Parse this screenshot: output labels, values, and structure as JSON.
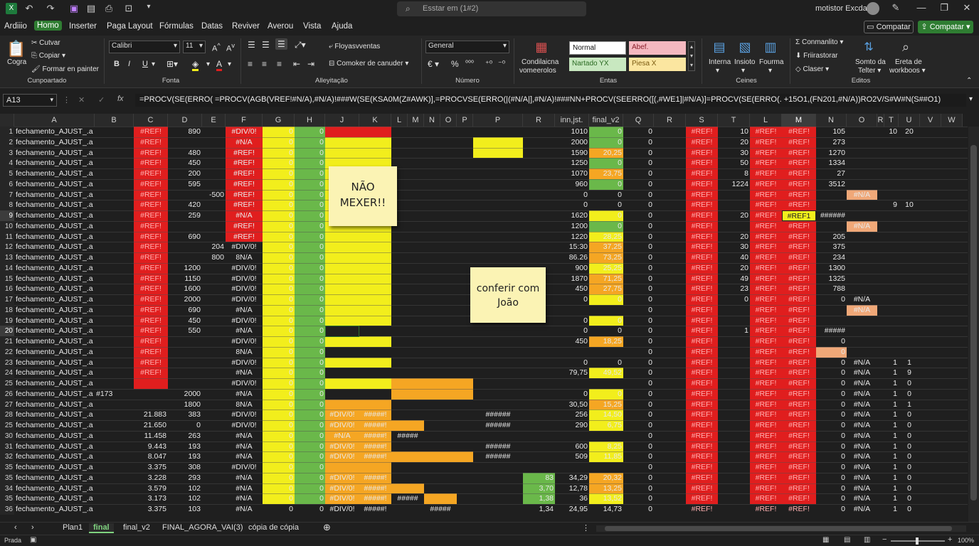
{
  "title_bar": {
    "search_placeholder": "Esstar em (1#2)",
    "user_name": "motistor Excda"
  },
  "menu": [
    "Ardiiio",
    "Homo",
    "Inserter",
    "Paga Layout",
    "Fórmulas",
    "Datas",
    "Reviver",
    "Averou",
    "Vista",
    "Ajuda"
  ],
  "menu_active": "Homo",
  "share_buttons": {
    "comment": "Compatar",
    "share": "Compatar"
  },
  "ribbon": {
    "clipboard": {
      "paste": "Cogra",
      "cut": "Cutvar",
      "copy": "Copiar",
      "format_painter": "Formar en painter",
      "group": "Cunpoartado"
    },
    "font": {
      "name": "Calibri",
      "size": "11",
      "group": "Fonta",
      "bold": "B",
      "italic": "I",
      "underline": "U"
    },
    "align": {
      "wrap": "Floyasvventas",
      "merge": "Comoker de canuder",
      "group": "Alleyitação"
    },
    "number": {
      "format": "General",
      "currency": "€",
      "percent": "%",
      "group": "Número"
    },
    "styles": {
      "conditional": "Condilaicna",
      "conditional2": "vomeerolos",
      "normal": "Normal",
      "bad": "Abef.",
      "neutral": "Nartado YX",
      "good": "Piesa X",
      "group": "Entas"
    },
    "cells": {
      "insert": "Interna",
      "delete": "Insioto",
      "format": "Fourma",
      "group": "Ceines"
    },
    "editing": {
      "autosum": "Conmanlito",
      "fill": "Friirastorar",
      "clear": "Claser",
      "sort": "Somto da",
      "sort2": "Telter",
      "find": "Ereta de",
      "find2": "workboos",
      "group": "Editos"
    }
  },
  "formula_bar": {
    "namebox": "A13",
    "fx": "fx",
    "formula": "=PROCV(SE(ERRO(  =PROCV(AGB(VREF!#N/A),#N/A)!###W(SE(KSA0M(Z#AWK)],=PROCVSE(ERRO(|(#N/A|],#N/A)!###NN+PROCV(SEERRO([(,#WE1]|#N/A)]=PROCV(SE(ERRO(.  +15O1,(FN201,#N/A))RO2V/S#W#N(S##O1)"
  },
  "columns": [
    {
      "l": "A",
      "w": 113
    },
    {
      "l": "B",
      "w": 55
    },
    {
      "l": "C",
      "w": 48
    },
    {
      "l": "D",
      "w": 48
    },
    {
      "l": "E",
      "w": 33
    },
    {
      "l": "F",
      "w": 52
    },
    {
      "l": "G",
      "w": 45
    },
    {
      "l": "H",
      "w": 43
    },
    {
      "l": "J",
      "w": 48
    },
    {
      "l": "K",
      "w": 45
    },
    {
      "l": "L",
      "w": 23
    },
    {
      "l": "M",
      "w": 23
    },
    {
      "l": "N",
      "w": 23
    },
    {
      "l": "O",
      "w": 23
    },
    {
      "l": "P",
      "w": 23
    },
    {
      "l": "P",
      "w": 70
    },
    {
      "l": "R",
      "w": 45
    },
    {
      "l": "inn,jst.",
      "w": 48
    },
    {
      "l": "final_v2",
      "w": 48
    },
    {
      "l": "Q",
      "w": 43
    },
    {
      "l": "R",
      "w": 45
    },
    {
      "l": "S",
      "w": 45
    },
    {
      "l": "T",
      "w": 45
    },
    {
      "l": "L",
      "w": 45
    },
    {
      "l": "M",
      "w": 48
    },
    {
      "l": "N",
      "w": 43
    },
    {
      "l": "O",
      "w": 43
    },
    {
      "l": "R",
      "w": 10
    },
    {
      "l": "T",
      "w": 20
    },
    {
      "l": "U",
      "w": 30
    },
    {
      "l": "V",
      "w": 30
    },
    {
      "l": "W",
      "w": 30
    }
  ],
  "row_numbers": [
    "1",
    "2",
    "3",
    "4",
    "5",
    "6",
    "7",
    "8",
    "9",
    "10",
    "11",
    "12",
    "13",
    "14",
    "15",
    "16",
    "17",
    "18",
    "19",
    "20",
    "21",
    "22",
    "23",
    "24",
    "25",
    "26",
    "27",
    "28",
    "25",
    "30",
    "31",
    "32",
    "35",
    "35",
    "34",
    "35",
    "36"
  ],
  "rows": [
    {
      "D": "890",
      "F": "#DIV/0!",
      "G": "0",
      "H": "0",
      "inn": "1010",
      "fv2": "0",
      "Q": "0",
      "T": "10",
      "N": "105",
      "Tb": "10",
      "U": "20"
    },
    {
      "F": "#N/A",
      "G": "0",
      "H": "0",
      "inn": "2000",
      "fv2": "0",
      "Q": "0",
      "T": "20",
      "N": "273"
    },
    {
      "D": "480",
      "F": "#REF!",
      "G": "0",
      "H": "0",
      "inn": "1590",
      "fv2": "20,25",
      "Q": "0",
      "T": "30",
      "N": "1270"
    },
    {
      "D": "450",
      "F": "#REF!",
      "G": "0",
      "H": "0",
      "inn": "1250",
      "fv2": "0",
      "Q": "0",
      "T": "50",
      "N": "1334"
    },
    {
      "D": "200",
      "F": "#REF!",
      "G": "0",
      "H": "0",
      "inn": "1070",
      "fv2": "23,75",
      "Q": "0",
      "T": "8",
      "N": "27"
    },
    {
      "D": "595",
      "F": "#REF!",
      "G": "0",
      "H": "0",
      "inn": "960",
      "fv2": "0",
      "Q": "0",
      "S": "",
      "T": "1224",
      "N": "3512"
    },
    {
      "E": "-500",
      "F": "#REF!",
      "G": "0",
      "H": "0",
      "inn": "0",
      "fv2": "0",
      "Q": "0",
      "O": "#N/A"
    },
    {
      "D": "420",
      "F": "#REF!",
      "G": "0",
      "H": "0",
      "inn": "0",
      "fv2": "0",
      "Q": "0",
      "Tb": "9",
      "U": "10"
    },
    {
      "D": "259",
      "F": "#N/A",
      "G": "0",
      "H": "0",
      "inn": "1620",
      "fv2": "0",
      "Q": "0",
      "T": "20",
      "M": "#REF1",
      "N": "######"
    },
    {
      "F": "#REF!",
      "G": "0",
      "H": "0",
      "inn": "1200",
      "fv2": "0",
      "Q": "0",
      "O": "#N/A"
    },
    {
      "D": "690",
      "F": "#REF!",
      "G": "0",
      "H": "0",
      "inn": "1220",
      "fv2": "28,25",
      "Q": "0",
      "T": "20",
      "N": "205"
    },
    {
      "E": "204",
      "F": "#DIV/0!",
      "G": "0",
      "H": "0",
      "inn": "15:30",
      "fv2": "37,25",
      "Q": "0",
      "T": "30",
      "N": "375"
    },
    {
      "E": "800",
      "F": "8N/A",
      "G": "0",
      "H": "0",
      "inn": "86.26",
      "fv2": "73,25",
      "Q": "0",
      "T": "40",
      "N": "234"
    },
    {
      "D": "1200",
      "F": "#DIV/0!",
      "G": "0",
      "H": "0",
      "inn": "900",
      "fv2": "25,25",
      "Q": "0",
      "T": "20",
      "N": "1300"
    },
    {
      "D": "1150",
      "F": "#DIV/0!",
      "G": "0",
      "H": "0",
      "inn": "1870",
      "fv2": "71,25",
      "Q": "0",
      "T": "49",
      "N": "1325"
    },
    {
      "D": "1600",
      "F": "#DIV/0!",
      "G": "0",
      "H": "0",
      "inn": "450",
      "fv2": "27,75",
      "Q": "0",
      "T": "23",
      "N": "788"
    },
    {
      "D": "2000",
      "F": "#DIV/0!",
      "G": "0",
      "H": "0",
      "inn": "0",
      "fv2": "0",
      "Q": "0",
      "T": "0",
      "N": "0",
      "O": "#N/A"
    },
    {
      "D": "690",
      "F": "#N/A",
      "G": "0",
      "H": "0",
      "Q": "0",
      "O": "#N/A"
    },
    {
      "D": "450",
      "F": "#DIV/0!",
      "G": "0",
      "H": "0",
      "inn": "0",
      "fv2": "0",
      "Q": "0"
    },
    {
      "D": "550",
      "F": "#N/A",
      "G": "0",
      "H": "0",
      "inn": "0",
      "fv2": "0",
      "Q": "0",
      "T": "1",
      "N": "#####"
    },
    {
      "F": "#DIV/0!",
      "G": "0",
      "H": "0",
      "inn": "450",
      "fv2": "18,25",
      "Q": "0",
      "N": "0"
    },
    {
      "F": "8N/A",
      "G": "0",
      "H": "0",
      "Q": "0",
      "N": "0"
    },
    {
      "F": "#DIV/0!",
      "G": "0",
      "H": "0",
      "inn": "0",
      "fv2": "0",
      "Q": "0",
      "N": "0",
      "O": "#N/A",
      "Tb": "1",
      "U": "1"
    },
    {
      "F": "#N/A",
      "G": "0",
      "H": "0",
      "inn": "79,75",
      "fv2": "49,52",
      "Q": "0",
      "N": "0",
      "O": "#N/A",
      "Tb": "1",
      "U": "9"
    },
    {
      "F": "#DIV/0!",
      "G": "0",
      "H": "0",
      "Q": "0",
      "N": "0",
      "O": "#N/A",
      "Tb": "1",
      "U": "0"
    },
    {
      "B": "#173",
      "D": "2000",
      "F": "#N/A",
      "G": "0",
      "H": "0",
      "inn": "0",
      "fv2": "0",
      "Q": "0",
      "N": "0",
      "O": "#N/A",
      "Tb": "1",
      "U": "0"
    },
    {
      "D": "1800",
      "F": "8N/A",
      "G": "0",
      "H": "0",
      "inn": "30,50",
      "fv2": "15,25",
      "Q": "0",
      "N": "0",
      "O": "#N/A",
      "Tb": "1",
      "U": "1"
    },
    {
      "C": "21.883",
      "D": "383",
      "F": "#DIV/0!",
      "G": "0",
      "H": "0",
      "J": "#DIV/0!",
      "K": "#####!",
      "P2": "######",
      "inn": "256",
      "fv2": "14,50",
      "Q": "0",
      "N": "0",
      "O": "#N/A",
      "Tb": "1",
      "U": "0"
    },
    {
      "C": "21.650",
      "D": "0",
      "F": "#DIV/0!",
      "G": "0",
      "H": "0",
      "J": "#DIV/0!",
      "K": "#####!",
      "P2": "######",
      "inn": "290",
      "fv2": "6,75",
      "Q": "0",
      "N": "0",
      "O": "#N/A",
      "Tb": "1",
      "U": "0"
    },
    {
      "C": "11.458",
      "D": "263",
      "F": "#N/A",
      "G": "0",
      "H": "0",
      "J": "#N/A",
      "K": "#####!",
      "LM": "#####",
      "Q": "0",
      "N": "0",
      "O": "#N/A",
      "Tb": "1",
      "U": "0"
    },
    {
      "C": "9.443",
      "D": "193",
      "F": "#N/A",
      "G": "0",
      "H": "0",
      "J": "#DIV/0!",
      "K": "#####!",
      "P2": "######",
      "inn": "600",
      "fv2": "8,25",
      "Q": "0",
      "N": "0",
      "O": "#N/A",
      "Tb": "1",
      "U": "0"
    },
    {
      "C": "8.047",
      "D": "193",
      "F": "#N/A",
      "G": "0",
      "H": "0",
      "J": "#DIV/0!",
      "K": "#####!",
      "P2": "######",
      "inn": "509",
      "fv2": "11,85",
      "Q": "0",
      "N": "0",
      "O": "#N/A",
      "Tb": "1",
      "U": "0"
    },
    {
      "C": "3.375",
      "D": "308",
      "F": "#DIV/0!",
      "G": "0",
      "H": "0",
      "Q": "0",
      "N": "0",
      "O": "#N/A",
      "Tb": "1",
      "U": "0"
    },
    {
      "C": "3.228",
      "D": "293",
      "F": "#N/A",
      "G": "0",
      "H": "0",
      "J": "#DIV/0!",
      "K": "#####!",
      "R": "83",
      "inn": "34,29",
      "fv2": "20,32",
      "Q": "0",
      "N": "0",
      "O": "#N/A",
      "Tb": "1",
      "U": "0"
    },
    {
      "C": "3.579",
      "D": "102",
      "F": "#N/A",
      "G": "0",
      "H": "0",
      "J": "#DIV/0!",
      "K": "#####!",
      "R": "3,70",
      "inn": "12,78",
      "fv2": "13,25",
      "Q": "0",
      "N": "0",
      "O": "#N/A",
      "Tb": "1",
      "U": "0"
    },
    {
      "C": "3.173",
      "D": "102",
      "F": "#N/A",
      "G": "0",
      "H": "0",
      "J": "#DIV/0!",
      "K": "#####!",
      "LM": "#####",
      "R": "1,38",
      "inn": "36",
      "fv2": "13,52",
      "Q": "0",
      "N": "0",
      "O": "#N/A",
      "Tb": "1",
      "U": "0"
    },
    {
      "C": "3.375",
      "D": "103",
      "F": "#N/A",
      "G": "0",
      "H": "0",
      "J": "#DIV/0!",
      "K": "#####!",
      "NO": "#####",
      "R": "1,34",
      "inn": "24,95",
      "fv2": "14,73",
      "Q": "0",
      "N": "0",
      "O": "#N/A",
      "Tb": "1",
      "U": "0"
    }
  ],
  "row_label": "fechamento_AJUST_.a",
  "ref_error": "#REF!",
  "notes": [
    {
      "text": "NÃO MEXER!!"
    },
    {
      "text": "conferir com João"
    }
  ],
  "sheet_tabs": [
    "Plan1",
    "final",
    "final_v2",
    "FINAL_AGORA_VAI(3)",
    "cópia de cópia"
  ],
  "active_sheet": "final",
  "status": {
    "ready": "Prada",
    "zoom": "100%"
  },
  "colors": {
    "red": "#e01e1e",
    "yellow": "#f2ee1c",
    "green": "#6ab84a",
    "orange": "#f5a623",
    "peach": "#f0a878",
    "accent": "#2f7d32"
  }
}
